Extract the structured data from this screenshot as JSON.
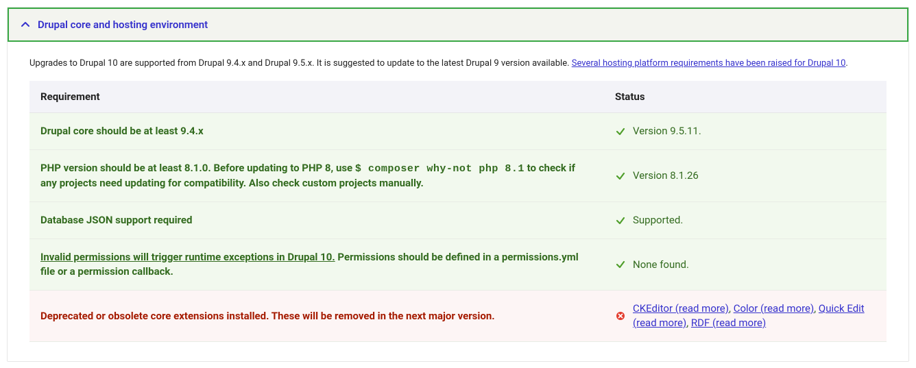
{
  "panel": {
    "title": "Drupal core and hosting environment"
  },
  "intro": {
    "text_before_link": "Upgrades to Drupal 10 are supported from Drupal 9.4.x and Drupal 9.5.x. It is suggested to update to the latest Drupal 9 version available. ",
    "link_text": "Several hosting platform requirements have been raised for Drupal 10",
    "after_link": "."
  },
  "table": {
    "headers": {
      "requirement": "Requirement",
      "status": "Status"
    },
    "rows": [
      {
        "status_kind": "ok",
        "status_text": "Version 9.5.11."
      },
      {
        "status_kind": "ok",
        "status_text": "Version 8.1.26"
      },
      {
        "status_kind": "ok",
        "status_text": "Supported."
      },
      {
        "status_kind": "ok",
        "status_text": "None found."
      },
      {
        "status_kind": "error"
      }
    ],
    "r0": {
      "req_text": "Drupal core should be at least 9.4.x"
    },
    "r1": {
      "req_before_code": "PHP version should be at least 8.1.0. Before updating to PHP 8, use ",
      "req_code": "$ composer why-not php 8.1",
      "req_after_code": " to check if any projects need updating for compatibility. Also check custom projects manually."
    },
    "r2": {
      "req_text": "Database JSON support required"
    },
    "r3": {
      "req_link": "Invalid permissions will trigger runtime exceptions in Drupal 10.",
      "req_after_link": " Permissions should be defined in a permissions.yml file or a permission callback."
    },
    "r4": {
      "req_text": "Deprecated or obsolete core extensions installed. These will be removed in the next major version.",
      "status_parts": {
        "p1": "CKEditor (read more)",
        "c1": ", ",
        "p2": "Color (read more)",
        "c2": ", ",
        "p3": "Quick Edit (read more)",
        "c3": ", ",
        "p4": "RDF (read more)"
      }
    }
  }
}
